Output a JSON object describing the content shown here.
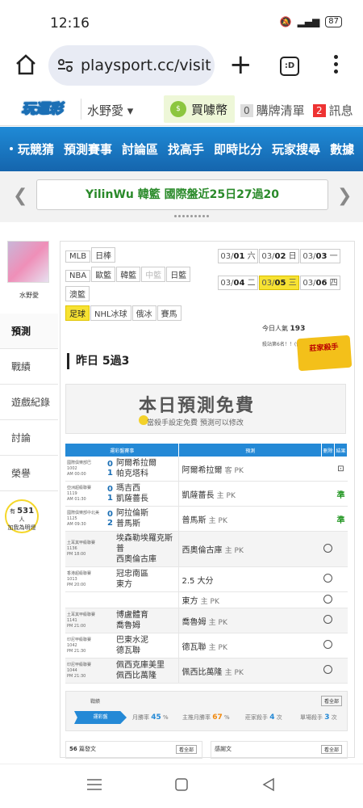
{
  "status": {
    "time": "12:16",
    "battery": "87"
  },
  "browser": {
    "url": "playsport.cc/visit",
    "tabs_icon_label": ":D"
  },
  "topnav": {
    "logo": "玩運彩",
    "user": "水野愛 ▾",
    "coins": "買噱幣",
    "cart_count": "0",
    "cart_label": "購牌清單",
    "msg_count": "2",
    "msg_label": "訊息"
  },
  "bluebar": {
    "items": [
      "玩競猜",
      "預測賽事",
      "討論區",
      "找高手",
      "即時比分",
      "玩家搜尋",
      "數據"
    ]
  },
  "marquee": {
    "text": "YilinWu 韓籃 國際盤近25日27過20"
  },
  "sidebar": {
    "username": "水野愛",
    "items": [
      "預測",
      "戰績",
      "遊戲紀錄",
      "討論",
      "榮譽"
    ],
    "bulb_pre": "有",
    "bulb_count": "531",
    "bulb_post": "人",
    "bulb_line2": "加我為明燈"
  },
  "leagues": [
    {
      "label": "MLB",
      "state": "normal"
    },
    {
      "label": "日棒",
      "state": "normal"
    },
    {
      "label": "NBA",
      "state": "normal"
    },
    {
      "label": "歐籃",
      "state": "normal"
    },
    {
      "label": "韓籃",
      "state": "normal"
    },
    {
      "label": "中籃",
      "state": "disabled"
    },
    {
      "label": "日籃",
      "state": "normal"
    },
    {
      "label": "澳籃",
      "state": "normal"
    },
    {
      "label": "足球",
      "state": "active"
    },
    {
      "label": "NHL冰球",
      "state": "normal"
    },
    {
      "label": "俄冰",
      "state": "normal"
    },
    {
      "label": "賽馬",
      "state": "normal"
    }
  ],
  "dates": [
    {
      "md": "03/",
      "d": "01",
      "w": "六",
      "on": false
    },
    {
      "md": "03/",
      "d": "02",
      "w": "日",
      "on": false
    },
    {
      "md": "03/",
      "d": "03",
      "w": "一",
      "on": false
    },
    {
      "md": "03/",
      "d": "04",
      "w": "二",
      "on": false
    },
    {
      "md": "03/",
      "d": "05",
      "w": "三",
      "on": true
    },
    {
      "md": "03/",
      "d": "06",
      "w": "四",
      "on": false
    }
  ],
  "popularity": {
    "label": "今日人氣",
    "value": "193",
    "rank": "殺站第6名！！(依殺站)"
  },
  "stamp": "莊家殺手",
  "yesterday": "昨日 5過3",
  "free": {
    "title": "本日預測免費",
    "sub": "當殺手設定免費 預測可以修改"
  },
  "table": {
    "headers": {
      "game": "運彩盤賽事",
      "pick": "預測",
      "del": "刪除",
      "res": "結果"
    },
    "rows": [
      {
        "league": "國際俱樂部巴",
        "no": "1002",
        "time": "AM 00:00",
        "s1": "0",
        "s2": "1",
        "t1": "阿爾希拉爾",
        "t2": "帕克塔科",
        "pick": "阿爾希拉爾",
        "pick_sub": "客 PK",
        "res": "⊡",
        "grey": false,
        "circle": false
      },
      {
        "league": "亞洲超級聯賽",
        "no": "1119",
        "time": "AM 01:30",
        "s1": "0",
        "s2": "1",
        "t1": "瑪吉西",
        "t2": "凱薩薔長",
        "pick": "凱薩薔長",
        "pick_sub": "主 PK",
        "res": "準",
        "grey": false,
        "circle": false
      },
      {
        "league": "國際俱樂部中北美",
        "no": "1125",
        "time": "AM 09:30",
        "s1": "0",
        "s2": "2",
        "t1": "阿拉倫斯",
        "t2": "普馬斯",
        "pick": "普馬斯",
        "pick_sub": "主 PK",
        "res": "準",
        "grey": false,
        "circle": false
      },
      {
        "league": "土耳其甲級聯賽",
        "no": "1136",
        "time": "PM 18:00",
        "s1": "",
        "s2": "",
        "t1": "埃森勒埃羅克斯普",
        "t2": "西奧倫古庫",
        "pick": "西奧倫古庫",
        "pick_sub": "主 PK",
        "res": "",
        "grey": true,
        "circle": true
      },
      {
        "league": "香港超級聯賽",
        "no": "1013",
        "time": "PM 20:00",
        "s1": "",
        "s2": "",
        "t1": "冠忠南區",
        "t2": "東方",
        "pick": "2.5 大分",
        "pick_sub": "",
        "res": "",
        "grey": false,
        "circle": true
      },
      {
        "league": "",
        "no": "",
        "time": "",
        "s1": "",
        "s2": "",
        "t1": "",
        "t2": "",
        "pick": "東方",
        "pick_sub": "主 PK",
        "res": "",
        "grey": false,
        "circle": true
      },
      {
        "league": "土耳其甲級聯賽",
        "no": "1141",
        "time": "PM 21:00",
        "s1": "",
        "s2": "",
        "t1": "博盧體育",
        "t2": "喬魯姆",
        "pick": "喬魯姆",
        "pick_sub": "主 PK",
        "res": "",
        "grey": true,
        "circle": true
      },
      {
        "league": "印尼甲級聯賽",
        "no": "1042",
        "time": "PM 21:30",
        "s1": "",
        "s2": "",
        "t1": "巴東水泥",
        "t2": "德瓦聯",
        "pick": "德瓦聯",
        "pick_sub": "主 PK",
        "res": "",
        "grey": false,
        "circle": true
      },
      {
        "league": "印尼甲級聯賽",
        "no": "1044",
        "time": "PM 21:30",
        "s1": "",
        "s2": "",
        "t1": "佩西克庫美里",
        "t2": "佩西比萬隆",
        "pick": "佩西比萬隆",
        "pick_sub": "主 PK",
        "res": "",
        "grey": true,
        "circle": true
      }
    ]
  },
  "stats": {
    "label": "戰績",
    "all": "看全部",
    "tab": "運彩盤",
    "month_win": "月勝率",
    "month_win_val": "45",
    "main_month_win": "主推月勝率",
    "main_month_win_val": "67",
    "killer": "莊家殺手",
    "killer_val": "4",
    "single_killer": "單場殺手",
    "single_killer_val": "3"
  },
  "posts": {
    "count": "56",
    "label": "篇發文",
    "all": "看全部",
    "right_label": "感謝文",
    "right_all": "看全部"
  }
}
